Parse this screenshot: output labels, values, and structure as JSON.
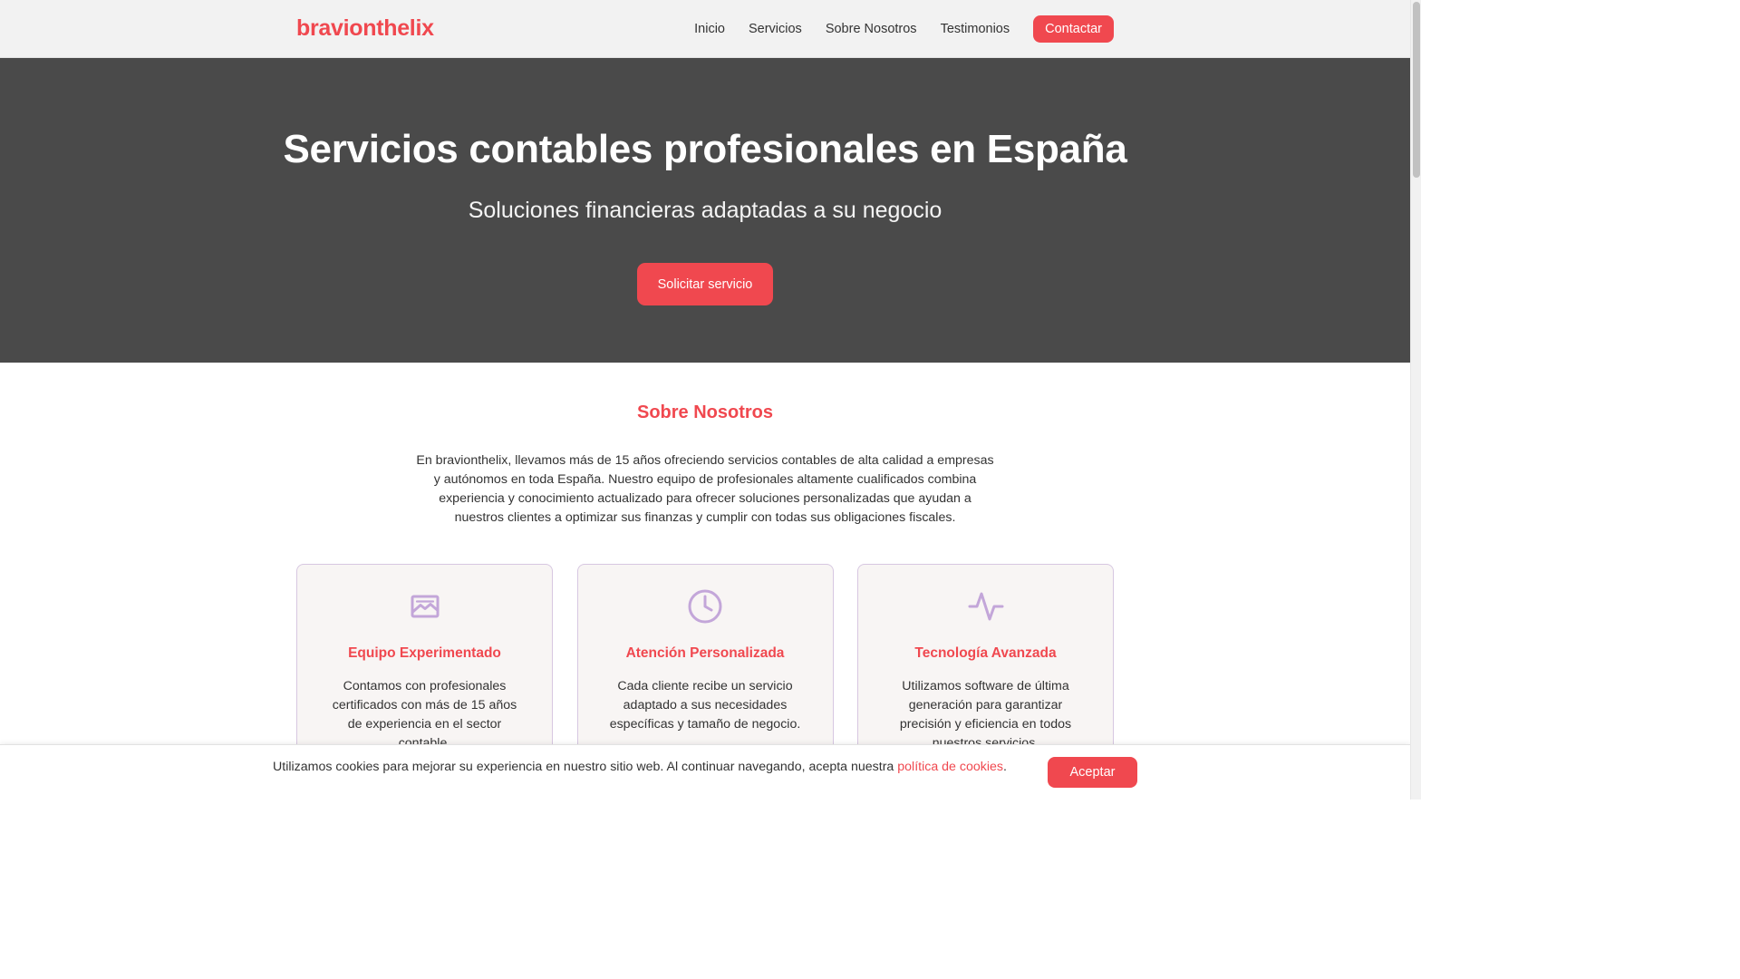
{
  "brand": {
    "name": "bravionthelix",
    "accent_color": "#f0484f",
    "hero_bg": "#4a4a4a",
    "icon_color": "#c3a6d9"
  },
  "nav": {
    "links": [
      "Inicio",
      "Servicios",
      "Sobre Nosotros",
      "Testimonios"
    ],
    "cta": "Contactar"
  },
  "hero": {
    "title": "Servicios contables profesionales en España",
    "subtitle": "Soluciones financieras adaptadas a su negocio",
    "button": "Solicitar servicio"
  },
  "about": {
    "title": "Sobre Nosotros",
    "text": "En bravionthelix, llevamos más de 15 años ofreciendo servicios contables de alta calidad a empresas y autónomos en toda España. Nuestro equipo de profesionales altamente cualificados combina experiencia y conocimiento actualizado para ofrecer soluciones personalizadas que ayudan a nuestros clientes a optimizar sus finanzas y cumplir con todas sus obligaciones fiscales.",
    "cards": [
      {
        "icon": "image-icon",
        "title": "Equipo Experimentado",
        "text": "Contamos con profesionales certificados con más de 15 años de experiencia en el sector contable."
      },
      {
        "icon": "clock-icon",
        "title": "Atención Personalizada",
        "text": "Cada cliente recibe un servicio adaptado a sus necesidades específicas y tamaño de negocio."
      },
      {
        "icon": "activity-icon",
        "title": "Tecnología Avanzada",
        "text": "Utilizamos software de última generación para garantizar precisión y eficiencia en todos nuestros servicios."
      }
    ]
  },
  "cookie": {
    "text": "Utilizamos cookies para mejorar su experiencia en nuestro sitio web. Al continuar navegando, acepta nuestra ",
    "link": "política de cookies",
    "suffix": ".",
    "button": "Aceptar"
  }
}
